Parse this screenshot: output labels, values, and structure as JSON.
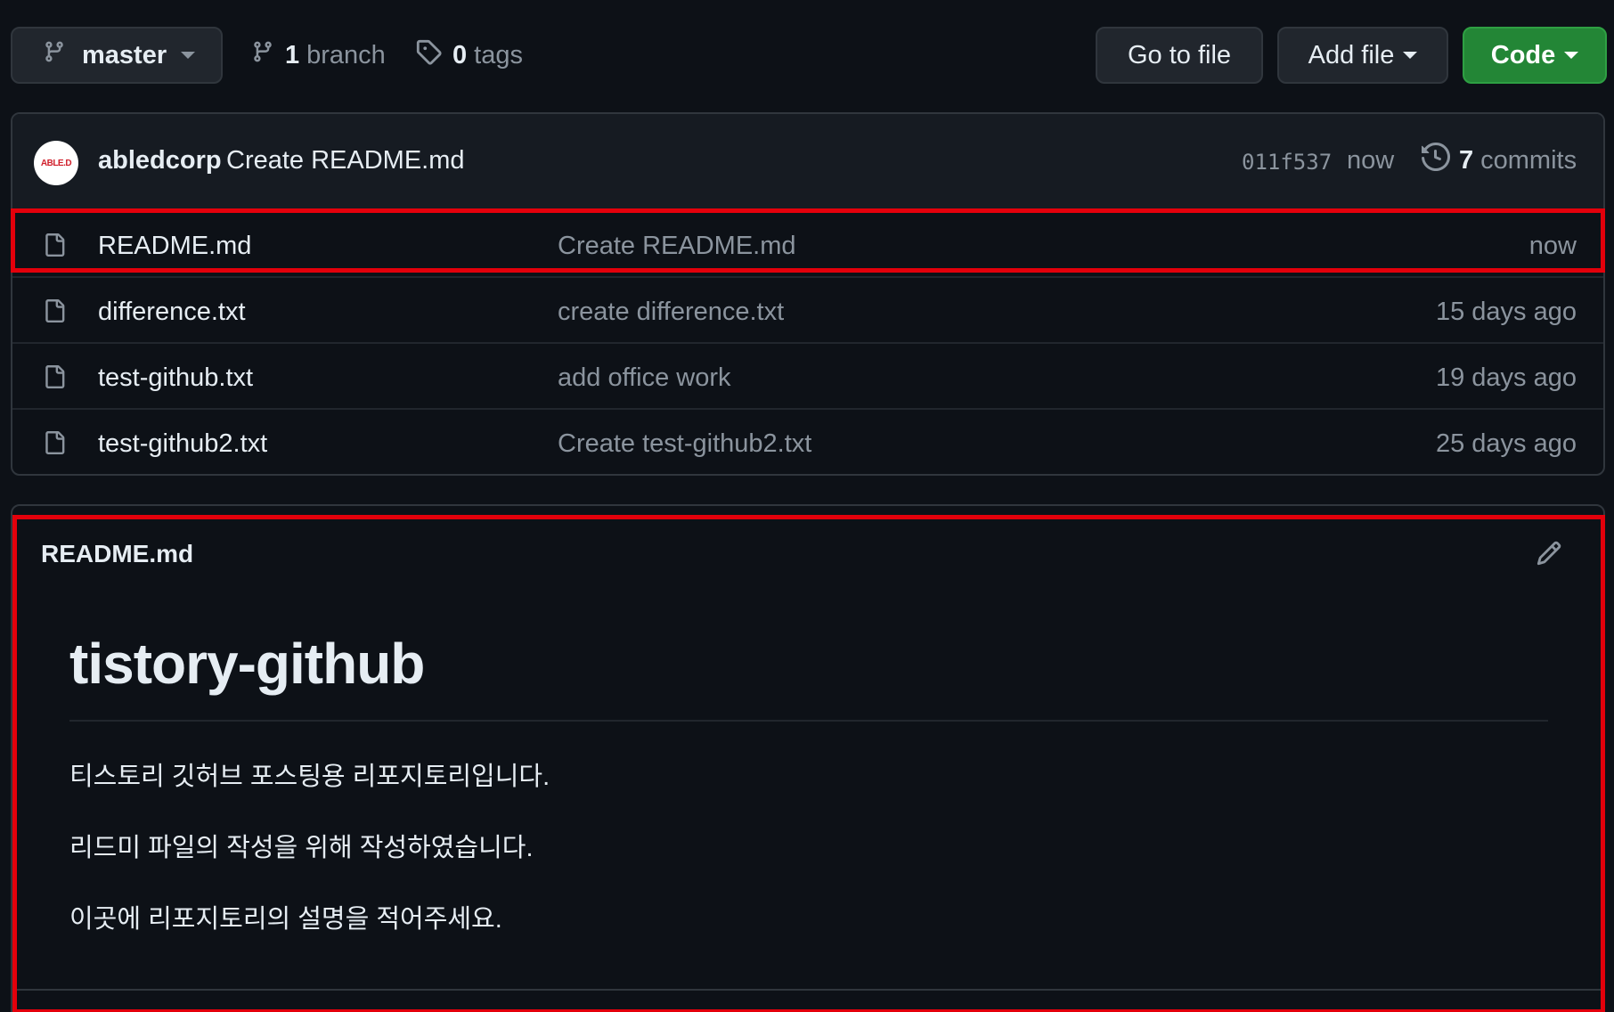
{
  "toolbar": {
    "branch_selector": "master",
    "branch_count": "1",
    "branch_word": "branch",
    "tag_count": "0",
    "tag_word": "tags",
    "go_to_file": "Go to file",
    "add_file": "Add file",
    "code": "Code"
  },
  "latest_commit": {
    "avatar_text": "ABLE.D",
    "author": "abledcorp",
    "message": "Create README.md",
    "sha": "011f537",
    "time": "now",
    "count": "7",
    "count_word": "commits"
  },
  "files": [
    {
      "name": "README.md",
      "message": "Create README.md",
      "age": "now"
    },
    {
      "name": "difference.txt",
      "message": "create difference.txt",
      "age": "15 days ago"
    },
    {
      "name": "test-github.txt",
      "message": "add office work",
      "age": "19 days ago"
    },
    {
      "name": "test-github2.txt",
      "message": "Create test-github2.txt",
      "age": "25 days ago"
    }
  ],
  "readme": {
    "filename": "README.md",
    "heading": "tistory-github",
    "paragraphs": [
      "티스토리 깃허브 포스팅용 리포지토리입니다.",
      "리드미 파일의 작성을 위해 작성하였습니다.",
      "이곳에 리포지토리의 설명을 적어주세요."
    ]
  },
  "colors": {
    "background": "#0d1117",
    "border": "#30363d",
    "code_button": "#238636",
    "highlight": "#e3000b",
    "muted_text": "#8b949e"
  },
  "icons": [
    "git-branch-icon",
    "tag-icon",
    "history-icon",
    "file-icon",
    "pencil-icon",
    "caret-down-icon"
  ]
}
